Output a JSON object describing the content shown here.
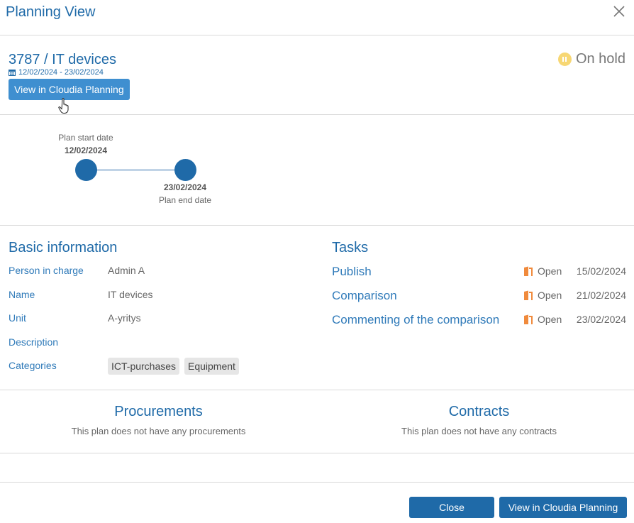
{
  "header": {
    "title": "Planning View",
    "close_icon": "close-icon"
  },
  "plan": {
    "title": "3787 / IT devices",
    "date_range": "12/02/2024 - 23/02/2024",
    "view_button_label": "View in Cloudia Planning",
    "status": "On hold",
    "status_color": "#f7d774"
  },
  "timeline": {
    "start_label": "Plan start date",
    "start_date": "12/02/2024",
    "end_date": "23/02/2024",
    "end_label": "Plan end date"
  },
  "basic_info": {
    "title": "Basic information",
    "rows": [
      {
        "label": "Person in charge",
        "value": "Admin A"
      },
      {
        "label": "Name",
        "value": "IT devices"
      },
      {
        "label": "Unit",
        "value": "A-yritys"
      },
      {
        "label": "Description",
        "value": ""
      },
      {
        "label": "Categories",
        "value": ""
      }
    ],
    "categories": [
      "ICT-purchases",
      "Equipment"
    ]
  },
  "tasks": {
    "title": "Tasks",
    "items": [
      {
        "name": "Publish",
        "status": "Open",
        "date": "15/02/2024"
      },
      {
        "name": "Comparison",
        "status": "Open",
        "date": "21/02/2024"
      },
      {
        "name": "Commenting of the comparison",
        "status": "Open",
        "date": "23/02/2024"
      }
    ],
    "status_icon_color": "#f08a3c"
  },
  "procurements": {
    "title": "Procurements",
    "empty_text": "This plan does not have any procurements"
  },
  "contracts": {
    "title": "Contracts",
    "empty_text": "This plan does not have any contracts"
  },
  "footer": {
    "close_label": "Close",
    "view_label": "View in Cloudia Planning"
  },
  "colors": {
    "accent": "#1f6aa8",
    "button_light": "#3f8fd0"
  }
}
